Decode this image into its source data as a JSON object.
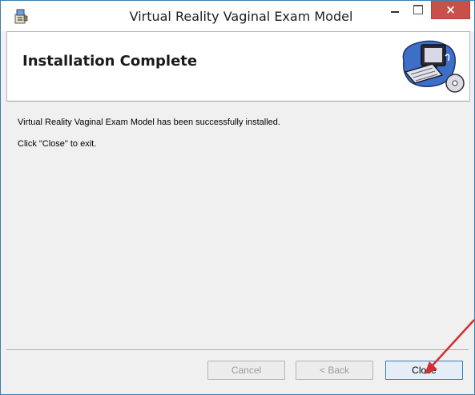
{
  "window": {
    "title": "Virtual Reality Vaginal Exam Model",
    "close_glyph": "×"
  },
  "banner": {
    "title": "Installation Complete"
  },
  "content": {
    "message": "Virtual Reality Vaginal Exam Model has been successfully installed.",
    "instruction": "Click \"Close\" to exit."
  },
  "buttons": {
    "cancel": "Cancel",
    "back": "< Back",
    "close": "Close"
  },
  "annotation": {
    "arrow_color": "#d32f2f"
  }
}
